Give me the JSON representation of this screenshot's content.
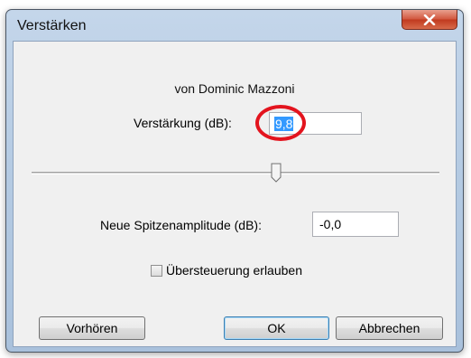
{
  "window": {
    "title": "Verstärken"
  },
  "dialog": {
    "author": "von Dominic Mazzoni",
    "gain_label": "Verstärkung (dB):",
    "gain_value": "9,8",
    "gain_slider_fraction": 0.6,
    "peak_label": "Neue Spitzenamplitude (dB):",
    "peak_value": "-0,0",
    "clip_label": "Übersteuerung erlauben",
    "clip_checked": false
  },
  "buttons": {
    "preview": "Vorhören",
    "ok": "OK",
    "cancel": "Abbrechen"
  },
  "icons": {
    "close": "close-icon"
  },
  "colors": {
    "highlight_ring": "#e3141e",
    "selection": "#3399ff"
  }
}
